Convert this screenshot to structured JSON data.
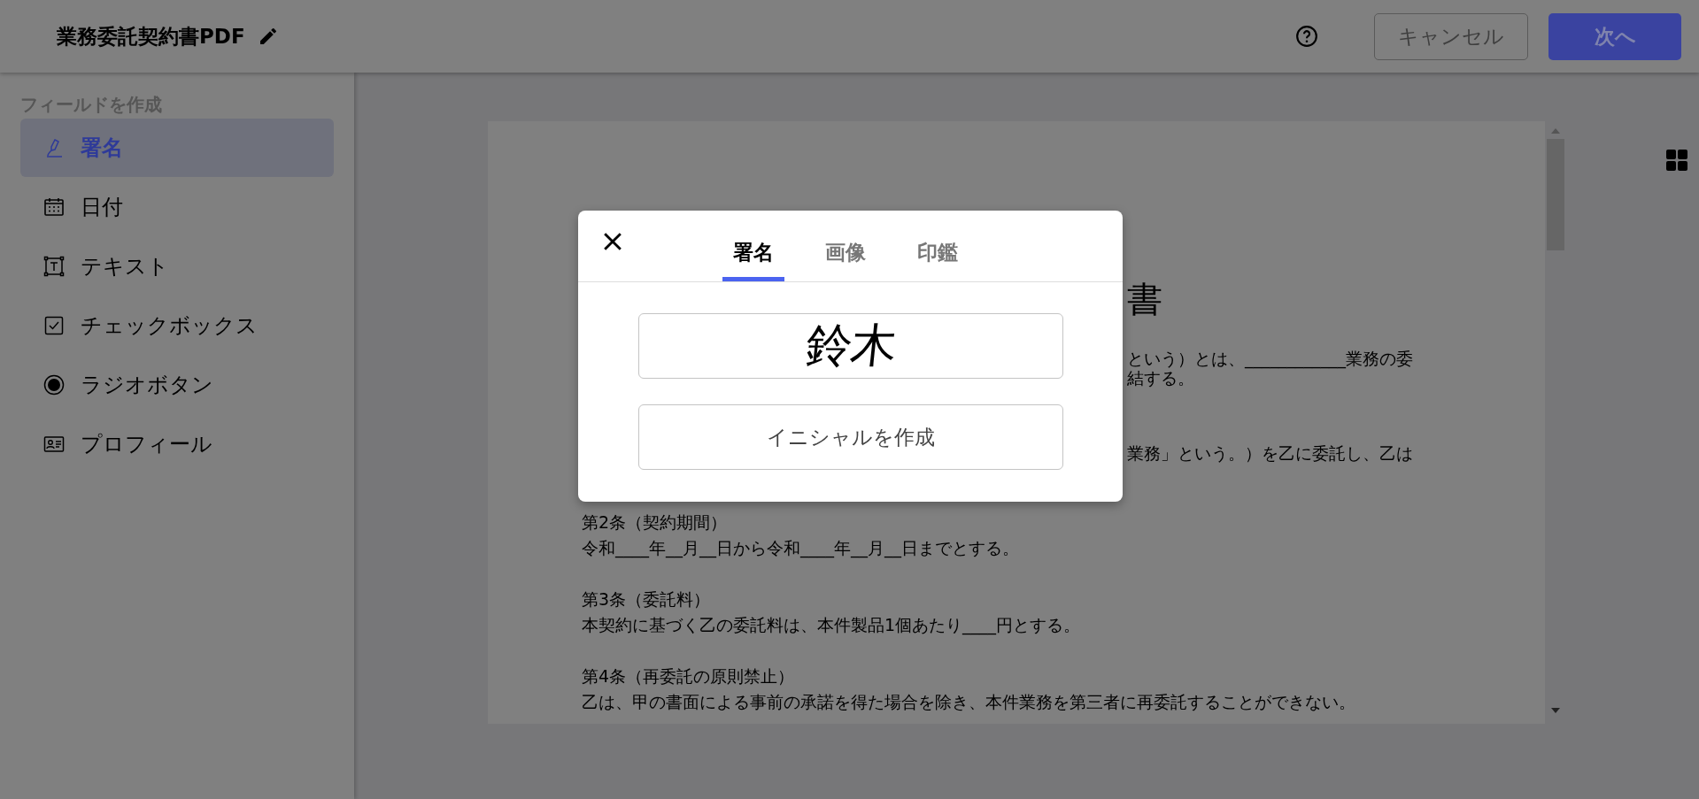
{
  "header": {
    "title": "業務委託契約書PDF",
    "buttons": [
      {
        "label": "キャンセル",
        "kind": "secondary"
      },
      {
        "label": "次へ",
        "kind": "primary"
      }
    ]
  },
  "sidebar": {
    "heading": "フィールドを作成",
    "items": [
      {
        "label": "署名",
        "kind": "signature",
        "selected": true
      },
      {
        "label": "日付",
        "kind": "date",
        "selected": false
      },
      {
        "label": "テキスト",
        "kind": "text",
        "selected": false
      },
      {
        "label": "チェックボックス",
        "kind": "checkbox",
        "selected": false
      },
      {
        "label": "ラジオボタン",
        "kind": "radio",
        "selected": false
      },
      {
        "label": "プロフィール",
        "kind": "profile",
        "selected": false
      }
    ]
  },
  "document": {
    "title_fragment": "書",
    "fragments": [
      [
        "という）とは、____________業務の委",
        "結する。"
      ],
      [
        "業務」という。）を乙に委託し、乙は"
      ]
    ],
    "articles": [
      {
        "heading": "第2条（契約期間）",
        "body": "令和____年__月__日から令和____年__月__日までとする。"
      },
      {
        "heading": "第3条（委託料）",
        "body": "本契約に基づく乙の委託料は、本件製品1個あたり____円とする。"
      },
      {
        "heading": "第4条（再委託の原則禁止）",
        "body": "乙は、甲の書面による事前の承諾を得た場合を除き、本件業務を第三者に再委託することができない。"
      }
    ]
  },
  "dialog": {
    "tabs": [
      {
        "label": "署名",
        "selected": true
      },
      {
        "label": "画像",
        "selected": false
      },
      {
        "label": "印鑑",
        "selected": false
      }
    ],
    "signature": "鈴木",
    "initials_button": "イニシャルを作成"
  }
}
